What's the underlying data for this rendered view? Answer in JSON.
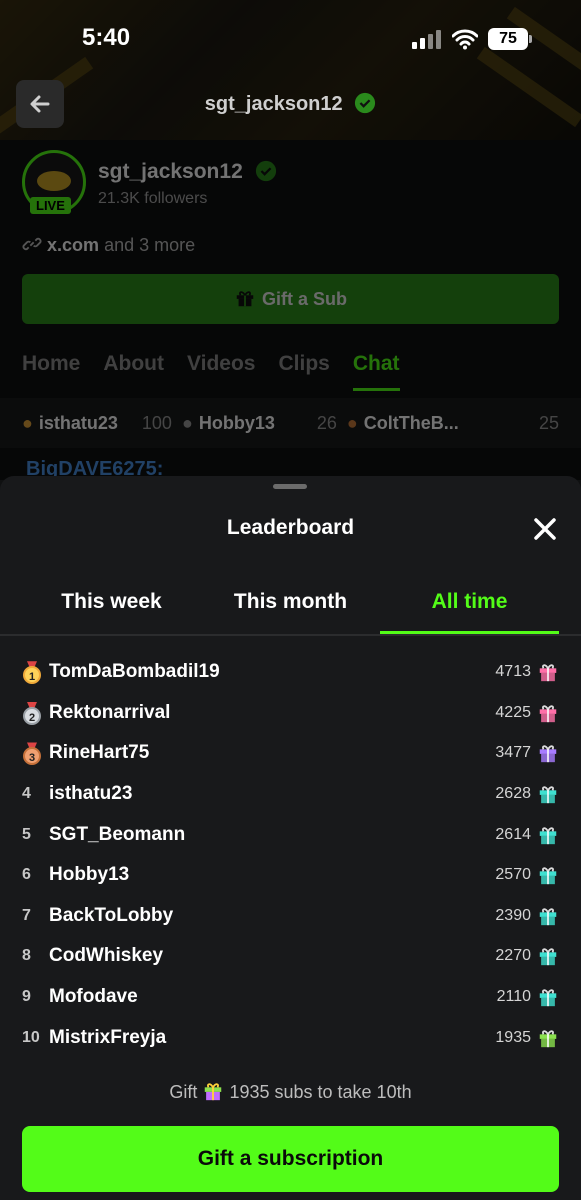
{
  "status_bar": {
    "time": "5:40",
    "battery": "75"
  },
  "header": {
    "title": "sgt_jackson12"
  },
  "profile": {
    "name": "sgt_jackson12",
    "followers": "21.3K followers",
    "live_badge": "LIVE",
    "links_primary": "x.com",
    "links_more": "and 3 more",
    "gift_sub_label": "Gift a Sub"
  },
  "channel_tabs": [
    "Home",
    "About",
    "Videos",
    "Clips",
    "Chat"
  ],
  "top_gifters": [
    {
      "name": "isthatu23",
      "count": "100"
    },
    {
      "name": "Hobby13",
      "count": "26"
    },
    {
      "name": "ColtTheB...",
      "count": "25"
    }
  ],
  "chat_peek": "BigDAVE6275:",
  "sheet": {
    "title": "Leaderboard",
    "tabs": [
      "This week",
      "This month",
      "All time"
    ],
    "active_tab": "All time",
    "rows": [
      {
        "rank": "1",
        "name": "TomDaBombadil19",
        "amount": "4713",
        "gift_color": "#ff6fa8"
      },
      {
        "rank": "2",
        "name": "Rektonarrival",
        "amount": "4225",
        "gift_color": "#ff6fa8"
      },
      {
        "rank": "3",
        "name": "RineHart75",
        "amount": "3477",
        "gift_color": "#a77bff"
      },
      {
        "rank": "4",
        "name": "isthatu23",
        "amount": "2628",
        "gift_color": "#3fe0d0"
      },
      {
        "rank": "5",
        "name": "SGT_Beomann",
        "amount": "2614",
        "gift_color": "#3fe0d0"
      },
      {
        "rank": "6",
        "name": "Hobby13",
        "amount": "2570",
        "gift_color": "#3fe0d0"
      },
      {
        "rank": "7",
        "name": "BackToLobby",
        "amount": "2390",
        "gift_color": "#3fe0d0"
      },
      {
        "rank": "8",
        "name": "CodWhiskey",
        "amount": "2270",
        "gift_color": "#3fe0d0"
      },
      {
        "rank": "9",
        "name": "Mofodave",
        "amount": "2110",
        "gift_color": "#3fe0d0"
      },
      {
        "rank": "10",
        "name": "MistrixFreyja",
        "amount": "1935",
        "gift_color": "#8be04e"
      }
    ],
    "footnote_before": "Gift",
    "footnote_after": "1935 subs to take 10th",
    "cta_label": "Gift a subscription"
  },
  "colors": {
    "accent": "#53fc18",
    "sheet_bg": "#18191b"
  }
}
